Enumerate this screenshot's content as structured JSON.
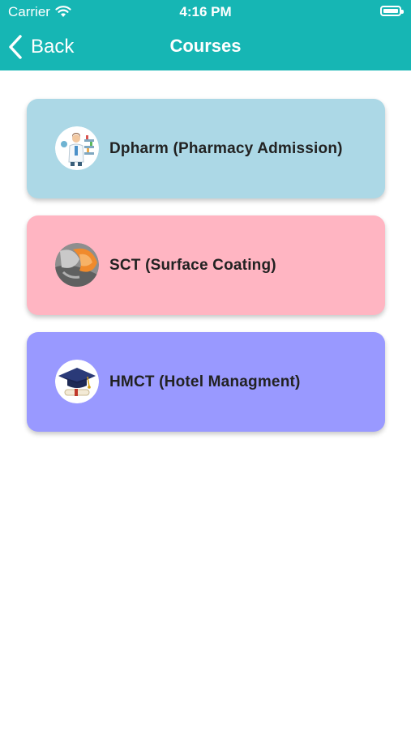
{
  "status_bar": {
    "carrier": "Carrier",
    "time": "4:16 PM"
  },
  "nav": {
    "back_label": "Back",
    "title": "Courses"
  },
  "courses": [
    {
      "label": "Dpharm (Pharmacy Admission)",
      "icon": "pharmacist-icon",
      "color": "#acd8e6"
    },
    {
      "label": "SCT (Surface Coating)",
      "icon": "surface-coating-icon",
      "color": "#ffb5c2"
    },
    {
      "label": "HMCT (Hotel Managment)",
      "icon": "graduation-cap-icon",
      "color": "#9999ff"
    }
  ],
  "colors": {
    "header": "#16b6b4"
  }
}
